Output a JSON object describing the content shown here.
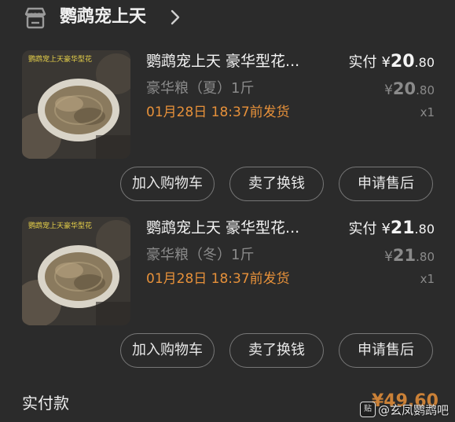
{
  "shop": {
    "name": "鹦鹉宠上天",
    "icon": "shop-icon",
    "chevron": "chevron-right-icon"
  },
  "items": [
    {
      "title": "鹦鹉宠上天 豪华型花...",
      "variant": "豪华粮（夏）1斤",
      "ship_time": "01月28日 18:37前发货",
      "paid_label": "实付",
      "paid_yen": "¥",
      "paid_int": "20",
      "paid_dec": ".80",
      "orig_yen": "¥",
      "orig_int": "20",
      "orig_dec": ".80",
      "quantity": "x1",
      "image_caption": "鹦鹉宠上天豪华型花",
      "buttons": [
        "加入购物车",
        "卖了换钱",
        "申请售后"
      ]
    },
    {
      "title": "鹦鹉宠上天 豪华型花...",
      "variant": "豪华粮（冬）1斤",
      "ship_time": "01月28日 18:37前发货",
      "paid_label": "实付",
      "paid_yen": "¥",
      "paid_int": "21",
      "paid_dec": ".80",
      "orig_yen": "¥",
      "orig_int": "21",
      "orig_dec": ".80",
      "quantity": "x1",
      "image_caption": "鹦鹉宠上天豪华型花",
      "buttons": [
        "加入购物车",
        "卖了换钱",
        "申请售后"
      ]
    }
  ],
  "footer": {
    "label": "实付款",
    "total": "¥49.60"
  },
  "watermark": {
    "logo": "贴",
    "text": "@玄凤鹦鹉吧"
  },
  "colors": {
    "background": "#2b2b2b",
    "accent_orange": "#e7913a",
    "muted": "#8a8a8a"
  }
}
